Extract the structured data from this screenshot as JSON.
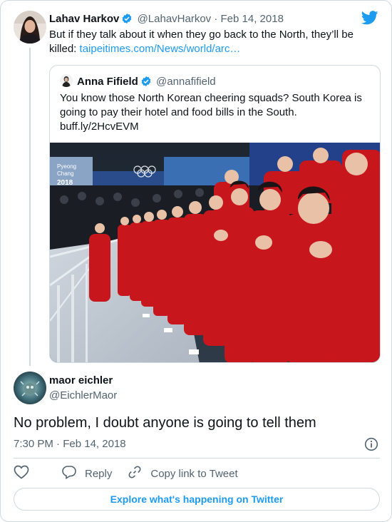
{
  "parent_tweet": {
    "name": "Lahav Harkov",
    "handle": "@LahavHarkov",
    "separator": "·",
    "date": "Feb 14, 2018",
    "text": "But if they talk about it when they go back to the North, they’ll be killed:",
    "link": "taipeitimes.com/News/world/arc…"
  },
  "quoted_tweet": {
    "name": "Anna Fifield",
    "handle": "@annafifield",
    "text": "You know those North Korean cheering squads? South Korea is going to pay their hotel and food bills in the South.",
    "link": "buff.ly/2HcvEVM",
    "arena_sign": [
      "Pyeong",
      "Chang",
      "2018"
    ]
  },
  "reply_tweet": {
    "name": "maor eichler",
    "handle": "@EichlerMaor",
    "text": "No problem, I doubt anyone is going to tell them",
    "time": "7:30 PM",
    "separator": "·",
    "date": "Feb 14, 2018"
  },
  "actions": {
    "reply_label": "Reply",
    "copy_link_label": "Copy link to Tweet"
  },
  "explore_label": "Explore what's happening on Twitter",
  "colors": {
    "accent": "#1d9bf0",
    "border": "#cfd9de",
    "muted_text": "#536471",
    "uniform_red": "#c8161d"
  },
  "icons": [
    "verified-badge-icon",
    "twitter-bird-icon",
    "info-icon",
    "heart-icon",
    "reply-bubble-icon",
    "link-icon"
  ]
}
